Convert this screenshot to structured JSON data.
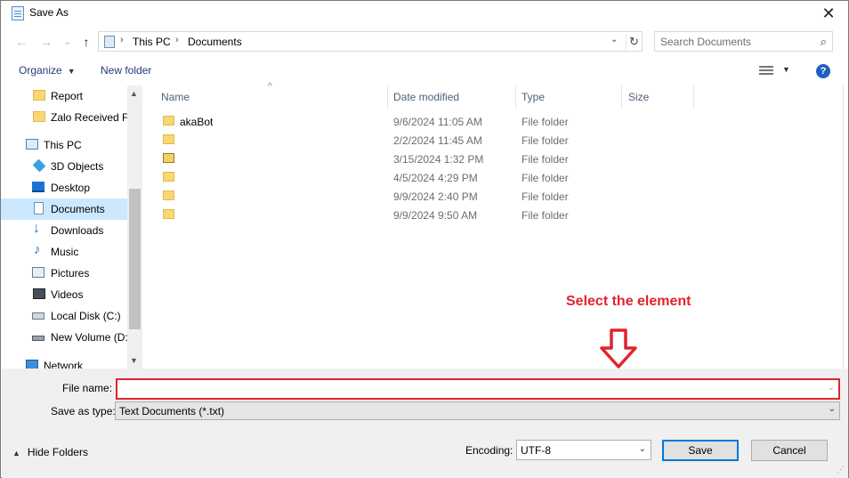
{
  "window": {
    "title": "Save As",
    "close_glyph": "✕"
  },
  "nav": {
    "back_glyph": "←",
    "forward_glyph": "→",
    "recent_glyph": "⌄",
    "up_glyph": "↑",
    "breadcrumb": [
      "This PC",
      "Documents"
    ],
    "separator_glyph": "›",
    "dropdown_glyph": "⌄",
    "refresh_glyph": "↻",
    "search_placeholder": "Search Documents",
    "search_glyph": "⌕"
  },
  "commands": {
    "organize": "Organize",
    "new_folder": "New folder",
    "help": "?"
  },
  "sidebar": {
    "items": [
      {
        "label": "Report",
        "icon": "folder-icon"
      },
      {
        "label": "Zalo Received Fi",
        "icon": "folder-icon"
      },
      {
        "label": "This PC",
        "icon": "pc-icon"
      },
      {
        "label": "3D Objects",
        "icon": "3d-objects-icon"
      },
      {
        "label": "Desktop",
        "icon": "desktop-icon"
      },
      {
        "label": "Documents",
        "icon": "documents-icon",
        "selected": true
      },
      {
        "label": "Downloads",
        "icon": "downloads-icon"
      },
      {
        "label": "Music",
        "icon": "music-icon"
      },
      {
        "label": "Pictures",
        "icon": "pictures-icon"
      },
      {
        "label": "Videos",
        "icon": "videos-icon"
      },
      {
        "label": "Local Disk (C:)",
        "icon": "local-disk-icon"
      },
      {
        "label": "New Volume (D:)",
        "icon": "volume-icon"
      },
      {
        "label": "Network",
        "icon": "network-icon"
      }
    ]
  },
  "columns": [
    "Name",
    "Date modified",
    "Type",
    "Size"
  ],
  "files": [
    {
      "name": "akaBot",
      "date": "9/6/2024 11:05 AM",
      "type": "File folder"
    },
    {
      "name": "",
      "date": "2/2/2024 11:45 AM",
      "type": "File folder"
    },
    {
      "name": "",
      "date": "3/15/2024 1:32 PM",
      "type": "File folder"
    },
    {
      "name": "",
      "date": "4/5/2024 4:29 PM",
      "type": "File folder"
    },
    {
      "name": "",
      "date": "9/9/2024 2:40 PM",
      "type": "File folder"
    },
    {
      "name": "",
      "date": "9/9/2024 9:50 AM",
      "type": "File folder"
    }
  ],
  "annotation": {
    "text": "Select the element",
    "color": "#e0242e"
  },
  "form": {
    "file_name_label": "File name:",
    "file_name_value": "",
    "save_as_type_label": "Save as type:",
    "save_as_type_value": "Text Documents (*.txt)",
    "encoding_label": "Encoding:",
    "encoding_value": "UTF-8",
    "hide_folders": "Hide Folders",
    "save": "Save",
    "cancel": "Cancel"
  }
}
